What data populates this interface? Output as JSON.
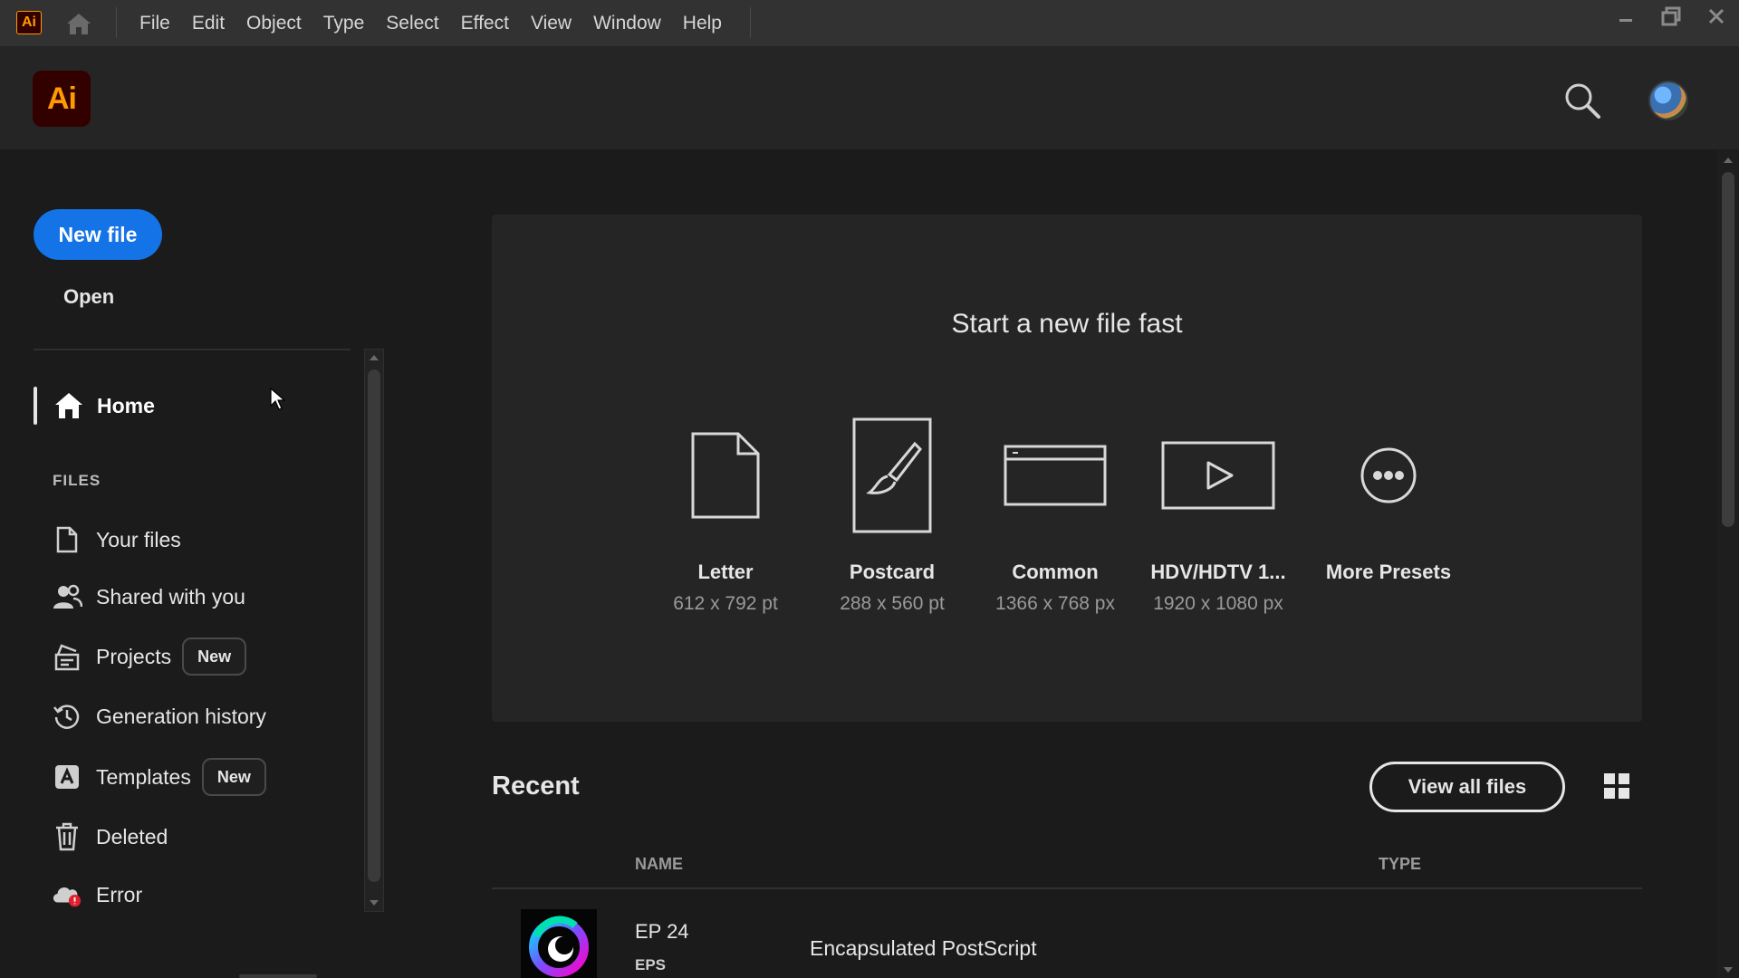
{
  "app": {
    "logo_text": "Ai",
    "menu": [
      "File",
      "Edit",
      "Object",
      "Type",
      "Select",
      "Effect",
      "View",
      "Window",
      "Help"
    ]
  },
  "header": {
    "logo_text": "Ai"
  },
  "sidebar": {
    "new_file_label": "New file",
    "open_label": "Open",
    "home_label": "Home",
    "files_heading": "FILES",
    "items": [
      {
        "label": "Your files",
        "icon": "file-icon",
        "badge": ""
      },
      {
        "label": "Shared with you",
        "icon": "users-icon",
        "badge": ""
      },
      {
        "label": "Projects",
        "icon": "projects-icon",
        "badge": "New"
      },
      {
        "label": "Generation history",
        "icon": "history-icon",
        "badge": ""
      },
      {
        "label": "Templates",
        "icon": "templates-icon",
        "badge": "New"
      },
      {
        "label": "Deleted",
        "icon": "trash-icon",
        "badge": ""
      },
      {
        "label": "Error",
        "icon": "cloud-error-icon",
        "badge": ""
      }
    ]
  },
  "quick_start": {
    "title": "Start a new file fast",
    "presets": [
      {
        "name": "Letter",
        "size": "612 x 792 pt",
        "icon": "letter-doc-icon"
      },
      {
        "name": "Postcard",
        "size": "288 x 560 pt",
        "icon": "postcard-brush-icon"
      },
      {
        "name": "Common",
        "size": "1366 x 768 px",
        "icon": "browser-window-icon"
      },
      {
        "name": "HDV/HDTV 1...",
        "size": "1920 x 1080 px",
        "icon": "video-play-icon"
      },
      {
        "name": "More Presets",
        "size": "",
        "icon": "more-icon"
      }
    ]
  },
  "recent": {
    "title": "Recent",
    "view_all_label": "View all files",
    "columns": {
      "name": "NAME",
      "type": "TYPE"
    },
    "rows": [
      {
        "name": "EP 24",
        "ext": "EPS",
        "type": "Encapsulated PostScript"
      }
    ]
  },
  "colors": {
    "accent": "#1473e6",
    "ai_brand": "#ff9a00",
    "ai_bg": "#330000"
  }
}
